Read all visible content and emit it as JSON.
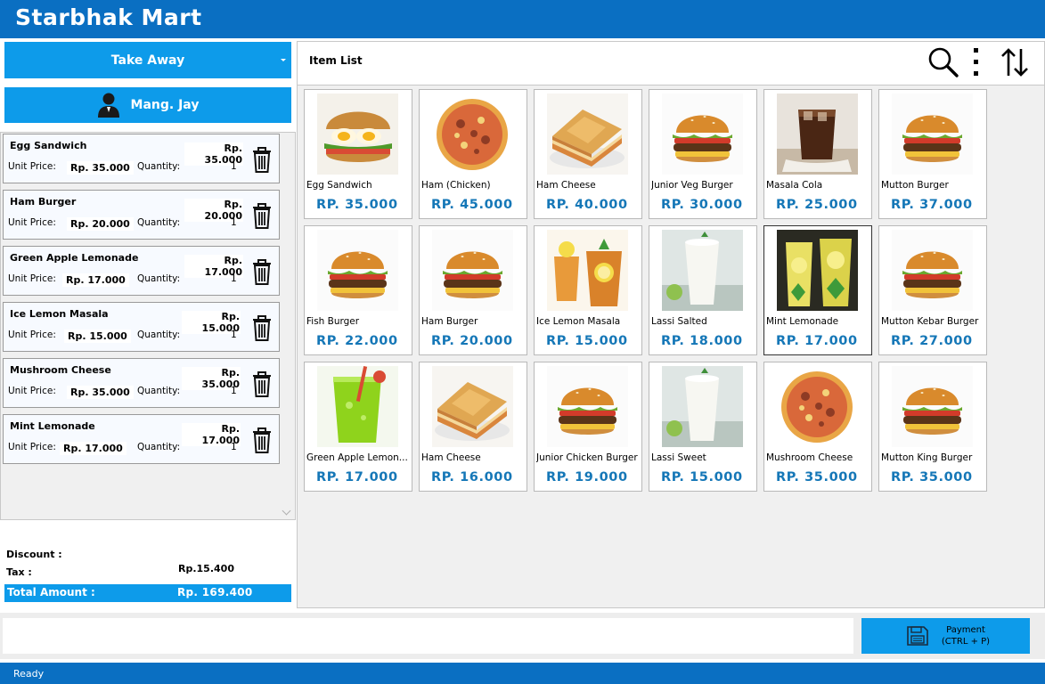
{
  "app": {
    "title": "Starbhak Mart"
  },
  "order_type": {
    "value": "Take Away"
  },
  "cashier": {
    "name": "Mang. Jay"
  },
  "cart": {
    "labels": {
      "unit_price": "Unit Price:",
      "quantity": "Quantity:"
    },
    "items": [
      {
        "name": "Egg Sandwich",
        "total": "Rp. 35.000",
        "unit_price": "Rp. 35.000",
        "quantity": "1"
      },
      {
        "name": "Ham Burger",
        "total": "Rp. 20.000",
        "unit_price": "Rp. 20.000",
        "quantity": "1"
      },
      {
        "name": "Green Apple Lemonade",
        "total": "Rp. 17.000",
        "unit_price": "Rp. 17.000",
        "quantity": "1"
      },
      {
        "name": "Ice Lemon Masala",
        "total": "Rp. 15.000",
        "unit_price": "Rp. 15.000",
        "quantity": "1"
      },
      {
        "name": "Mushroom Cheese",
        "total": "Rp. 35.000",
        "unit_price": "Rp. 35.000",
        "quantity": "1"
      },
      {
        "name": "Mint Lemonade",
        "total": "Rp. 17.000",
        "unit_price": "Rp. 17.000",
        "quantity": "1"
      }
    ]
  },
  "summary": {
    "discount_label": "Discount :",
    "discount_value": "",
    "tax_label": "Tax :",
    "tax_value": "Rp.15.400",
    "total_label": "Total Amount :",
    "total_value": "Rp. 169.400"
  },
  "item_list": {
    "title": "Item List",
    "products": [
      {
        "name": "Egg Sandwich",
        "price": "RP. 35.000",
        "img": "sandwich"
      },
      {
        "name": "Ham (Chicken)",
        "price": "RP. 45.000",
        "img": "pizza"
      },
      {
        "name": "Ham Cheese",
        "price": "RP. 40.000",
        "img": "toast"
      },
      {
        "name": "Junior Veg Burger",
        "price": "RP. 30.000",
        "img": "burger"
      },
      {
        "name": "Masala Cola",
        "price": "RP. 25.000",
        "img": "cola"
      },
      {
        "name": "Mutton Burger",
        "price": "RP. 37.000",
        "img": "burger"
      },
      {
        "name": "Fish Burger",
        "price": "RP. 22.000",
        "img": "burger"
      },
      {
        "name": "Ham Burger",
        "price": "RP. 20.000",
        "img": "burger"
      },
      {
        "name": "Ice Lemon Masala",
        "price": "RP. 15.000",
        "img": "icetea"
      },
      {
        "name": "Lassi Salted",
        "price": "RP. 18.000",
        "img": "lassi"
      },
      {
        "name": "Mint Lemonade",
        "price": "RP. 17.000",
        "img": "lemonade"
      },
      {
        "name": "Mutton Kebar Burger",
        "price": "RP. 27.000",
        "img": "burger"
      },
      {
        "name": "Green Apple Lemon...",
        "price": "RP. 17.000",
        "img": "greenjuice"
      },
      {
        "name": "Ham Cheese",
        "price": "RP. 16.000",
        "img": "toast"
      },
      {
        "name": "Junior Chicken Burger",
        "price": "RP. 19.000",
        "img": "burger"
      },
      {
        "name": "Lassi Sweet",
        "price": "RP. 15.000",
        "img": "lassi"
      },
      {
        "name": "Mushroom Cheese",
        "price": "RP. 35.000",
        "img": "pizza"
      },
      {
        "name": "Mutton King Burger",
        "price": "RP. 35.000",
        "img": "burger"
      }
    ]
  },
  "payment": {
    "label_line1": "Payment",
    "label_line2": "(CTRL + P)"
  },
  "status": {
    "text": "Ready"
  },
  "colors": {
    "header": "#0a6fc2",
    "accent": "#0d9bea",
    "price": "#1577b7"
  }
}
